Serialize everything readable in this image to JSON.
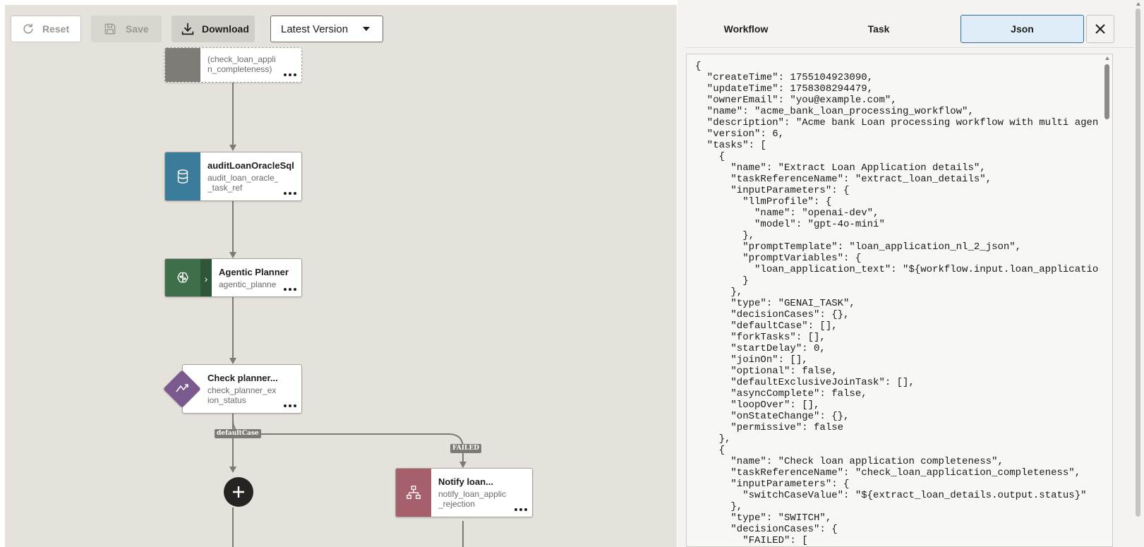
{
  "toolbar": {
    "reset_label": "Reset",
    "save_label": "Save",
    "download_label": "Download",
    "version_selected": "Latest Version"
  },
  "nodes": {
    "check_completeness": {
      "sub": "(check_loan_appli\nn_completeness)",
      "color": "#7f7b76"
    },
    "audit": {
      "title": "auditLoanOracleSql",
      "sub": "audit_loan_oracle_\n_task_ref",
      "color": "#3b7c9b",
      "icon": "database-icon"
    },
    "planner": {
      "title": "Agentic Planner",
      "sub": "agentic_planne",
      "color": "#3f6f4a",
      "icon": "brain-icon"
    },
    "check_status": {
      "title": "Check planner...",
      "sub": "check_planner_ex\nion_status",
      "color": "#7a5a8e",
      "icon": "switch-icon"
    },
    "notify": {
      "title": "Notify loan...",
      "sub": "notify_loan_applic\n_rejection",
      "color": "#a6606c",
      "icon": "hierarchy-icon"
    }
  },
  "edge_labels": {
    "default_case": "defaultCase",
    "failed": "FAILED"
  },
  "panel": {
    "tabs": [
      "Workflow",
      "Task",
      "Json"
    ],
    "active_tab": "Json",
    "json_text": "{\n  \"createTime\": 1755104923090,\n  \"updateTime\": 1758308294479,\n  \"ownerEmail\": \"you@example.com\",\n  \"name\": \"acme_bank_loan_processing_workflow\",\n  \"description\": \"Acme bank Loan processing workflow with multi agen\n  \"version\": 6,\n  \"tasks\": [\n    {\n      \"name\": \"Extract Loan Application details\",\n      \"taskReferenceName\": \"extract_loan_details\",\n      \"inputParameters\": {\n        \"llmProfile\": {\n          \"name\": \"openai-dev\",\n          \"model\": \"gpt-4o-mini\"\n        },\n        \"promptTemplate\": \"loan_application_nl_2_json\",\n        \"promptVariables\": {\n          \"loan_application_text\": \"${workflow.input.loan_applicatio\n        }\n      },\n      \"type\": \"GENAI_TASK\",\n      \"decisionCases\": {},\n      \"defaultCase\": [],\n      \"forkTasks\": [],\n      \"startDelay\": 0,\n      \"joinOn\": [],\n      \"optional\": false,\n      \"defaultExclusiveJoinTask\": [],\n      \"asyncComplete\": false,\n      \"loopOver\": [],\n      \"onStateChange\": {},\n      \"permissive\": false\n    },\n    {\n      \"name\": \"Check loan application completeness\",\n      \"taskReferenceName\": \"check_loan_application_completeness\",\n      \"inputParameters\": {\n        \"switchCaseValue\": \"${extract_loan_details.output.status}\"\n      },\n      \"type\": \"SWITCH\",\n      \"decisionCases\": {\n        \"FAILED\": ["
  }
}
